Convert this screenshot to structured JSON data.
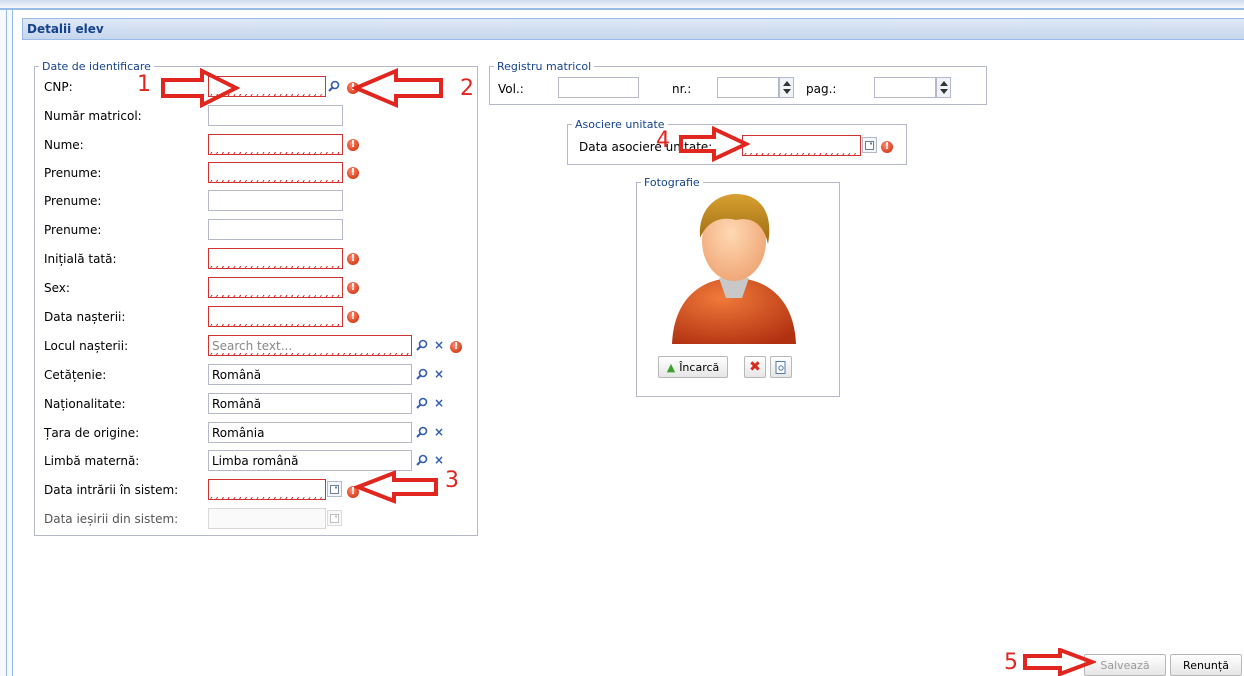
{
  "panel": {
    "title": "Detalii elev"
  },
  "identification": {
    "legend": "Date de identificare",
    "fields": {
      "cnp": {
        "label": "CNP:",
        "value": ""
      },
      "numar_matricol": {
        "label": "Număr matricol:",
        "value": ""
      },
      "nume": {
        "label": "Nume:",
        "value": ""
      },
      "prenume1": {
        "label": "Prenume:",
        "value": ""
      },
      "prenume2": {
        "label": "Prenume:",
        "value": ""
      },
      "prenume3": {
        "label": "Prenume:",
        "value": ""
      },
      "initiala_tata": {
        "label": "Inițială tată:",
        "value": ""
      },
      "sex": {
        "label": "Sex:",
        "value": ""
      },
      "data_nasterii": {
        "label": "Data nașterii:",
        "value": ""
      },
      "locul_nasterii": {
        "label": "Locul nașterii:",
        "placeholder": "Search text..."
      },
      "cetatenie": {
        "label": "Cetățenie:",
        "value": "Română"
      },
      "nationalitate": {
        "label": "Naționalitate:",
        "value": "Română"
      },
      "tara_origine": {
        "label": "Țara de origine:",
        "value": "România"
      },
      "limba_materna": {
        "label": "Limbă maternă:",
        "value": "Limba română"
      },
      "data_intrarii": {
        "label": "Data intrării în sistem:",
        "value": ""
      },
      "data_iesirii": {
        "label": "Data ieșirii din sistem:",
        "value": ""
      }
    }
  },
  "registru": {
    "legend": "Registru matricol",
    "vol_label": "Vol.:",
    "nr_label": "nr.:",
    "pag_label": "pag.:",
    "vol_value": "",
    "nr_value": "",
    "pag_value": ""
  },
  "asociere": {
    "legend": "Asociere unitate",
    "label": "Data asociere unitate:",
    "value": ""
  },
  "fotografie": {
    "legend": "Fotografie",
    "upload_label": "Încarcă"
  },
  "buttons": {
    "save": "Salvează",
    "cancel": "Renunță"
  },
  "annotations": [
    "1",
    "2",
    "3",
    "4",
    "5"
  ],
  "colors": {
    "annotation": "#e0261f",
    "header_text": "#15428b",
    "invalid_border": "#d03131"
  },
  "icons": [
    "search-icon",
    "clear-icon",
    "calendar-icon",
    "error-icon",
    "upload-arrow-icon",
    "delete-icon",
    "view-icon",
    "spinner-icon"
  ]
}
